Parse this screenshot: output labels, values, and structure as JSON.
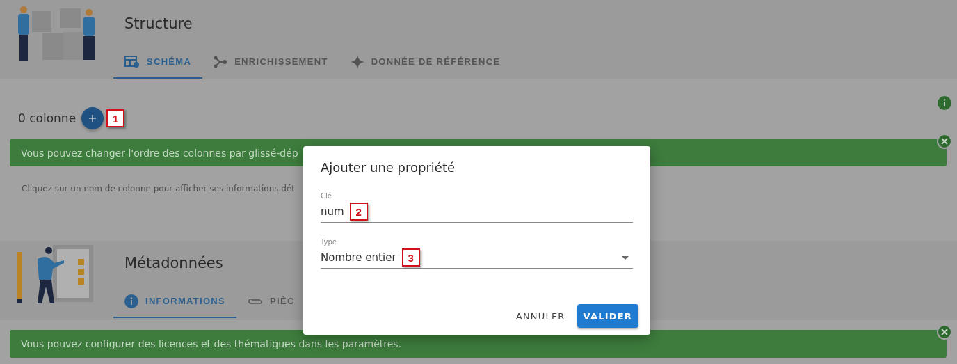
{
  "structure": {
    "title": "Structure",
    "tabs": [
      {
        "label": "SCHÉMA",
        "kind": "schema",
        "selected": true
      },
      {
        "label": "ENRICHISSEMENT",
        "kind": "branch",
        "selected": false
      },
      {
        "label": "DONNÉE DE RÉFÉRENCE",
        "kind": "sparkle",
        "selected": false
      }
    ],
    "column_count": "0 colonne",
    "add_callout": "1",
    "banner": "Vous pouvez changer l'ordre des colonnes par glissé-dép",
    "hint": "Cliquez sur un nom de colonne pour afficher ses informations dét"
  },
  "metadata": {
    "title": "Métadonnées",
    "tabs": [
      {
        "label": "INFORMATIONS",
        "kind": "info",
        "selected": true
      },
      {
        "label": "PIÈC",
        "kind": "clip",
        "selected": false
      }
    ],
    "banner": "Vous pouvez configurer des licences et des thématiques dans les paramètres."
  },
  "dialog": {
    "title": "Ajouter une propriété",
    "fields": [
      {
        "label": "Clé",
        "value": "num",
        "kind": "text",
        "callout": "2"
      },
      {
        "label": "Type",
        "value": "Nombre entier",
        "kind": "select",
        "callout": "3"
      }
    ],
    "buttons": [
      {
        "label": "ANNULER",
        "kind": "text"
      },
      {
        "label": "VALIDER",
        "kind": "primary"
      }
    ]
  }
}
